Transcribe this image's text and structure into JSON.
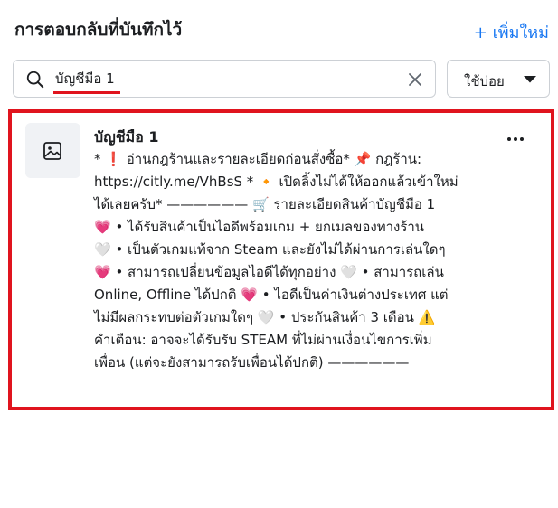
{
  "header": {
    "title": "การตอบกลับที่บันทึกไว้",
    "add_new_label": "+ เพิ่มใหม่"
  },
  "search": {
    "value": "บัญชีมือ 1"
  },
  "sort": {
    "selected": "ใช้บ่อย"
  },
  "icons": {
    "search": "search-icon",
    "clear": "close-icon",
    "caret": "caret-down-icon",
    "thumbnail": "image-icon",
    "more": "more-horizontal-icon"
  },
  "colors": {
    "accent": "#1877f2",
    "highlight": "#e0141e",
    "thumbnail_bg": "#f0f2f5"
  },
  "reply": {
    "title": "บัญชีมือ 1",
    "lines": [
      "* ❗ อ่านกฎร้านและรายละเอียดก่อนสั่งซื้อ* 📌 กฎร้าน:",
      "https://citly.me/VhBsS * 🔸 เปิดลิ้งไม่ได้ให้ออกแล้วเข้าใหม่",
      "ได้เลยครับ* —————— 🛒 รายละเอียดสินค้าบัญชีมือ 1",
      "💗 • ได้รับสินค้าเป็นไอดีพร้อมเกม + ยกเมลของทางร้าน",
      "🤍 • เป็นตัวเกมแท้จาก Steam และยังไม่ได้ผ่านการเล่นใดๆ",
      "💗 • สามารถเปลี่ยนข้อมูลไอดีได้ทุกอย่าง 🤍 • สามารถเล่น",
      "Online, Offline ได้ปกติ 💗 • ไอดีเป็นค่าเงินต่างประเทศ แต่",
      "ไม่มีผลกระทบต่อตัวเกมใดๆ 🤍 • ประกันสินค้า 3 เดือน ⚠️",
      "คำเตือน: อาจจะได้รับรับ STEAM ที่ไม่ผ่านเงื่อนไขการเพิ่ม",
      "เพื่อน (แต่จะยังสามารถรับเพื่อนได้ปกติ) ——————"
    ]
  }
}
